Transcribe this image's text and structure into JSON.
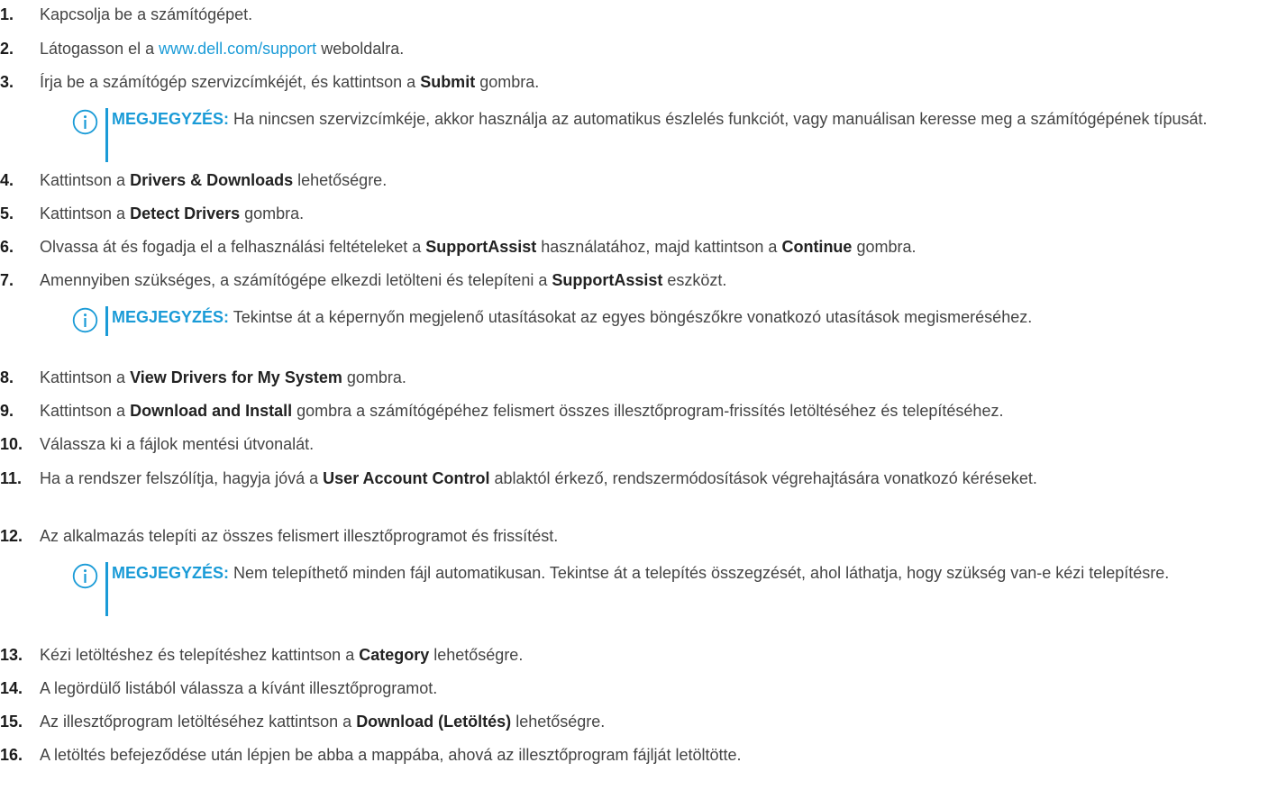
{
  "steps": [
    {
      "num": "1.",
      "parts": [
        {
          "t": "Kapcsolja be a számítógépet."
        }
      ]
    },
    {
      "num": "2.",
      "parts": [
        {
          "t": "Látogasson el a "
        },
        {
          "t": "www.dell.com/support",
          "link": true
        },
        {
          "t": " weboldalra."
        }
      ]
    },
    {
      "num": "3.",
      "parts": [
        {
          "t": "Írja be a számítógép szervizcímkéjét, és kattintson a "
        },
        {
          "t": "Submit",
          "b": true
        },
        {
          "t": " gombra."
        }
      ]
    },
    {
      "num": "4.",
      "parts": [
        {
          "t": "Kattintson a "
        },
        {
          "t": "Drivers & Downloads",
          "b": true
        },
        {
          "t": " lehetőségre."
        }
      ]
    },
    {
      "num": "5.",
      "parts": [
        {
          "t": "Kattintson a "
        },
        {
          "t": "Detect Drivers",
          "b": true
        },
        {
          "t": " gombra."
        }
      ]
    },
    {
      "num": "6.",
      "parts": [
        {
          "t": "Olvassa át és fogadja el a felhasználási feltételeket a "
        },
        {
          "t": "SupportAssist",
          "b": true
        },
        {
          "t": " használatához, majd kattintson a "
        },
        {
          "t": "Continue",
          "b": true
        },
        {
          "t": " gombra."
        }
      ]
    },
    {
      "num": "7.",
      "parts": [
        {
          "t": "Amennyiben szükséges, a számítógépe elkezdi letölteni és telepíteni a "
        },
        {
          "t": "SupportAssist",
          "b": true
        },
        {
          "t": " eszközt."
        }
      ]
    },
    {
      "num": "8.",
      "parts": [
        {
          "t": "Kattintson a "
        },
        {
          "t": "View Drivers for My System",
          "b": true
        },
        {
          "t": " gombra."
        }
      ]
    },
    {
      "num": "9.",
      "parts": [
        {
          "t": "Kattintson a "
        },
        {
          "t": "Download and Install",
          "b": true
        },
        {
          "t": " gombra a számítógépéhez felismert összes illesztőprogram-frissítés letöltéséhez és telepítéséhez."
        }
      ]
    },
    {
      "num": "10.",
      "parts": [
        {
          "t": "Válassza ki a fájlok mentési útvonalát."
        }
      ]
    },
    {
      "num": "11.",
      "parts": [
        {
          "t": "Ha a rendszer felszólítja, hagyja jóvá a "
        },
        {
          "t": "User Account Control",
          "b": true
        },
        {
          "t": " ablaktól érkező, rendszermódosítások végrehajtására vonatkozó kéréseket."
        }
      ]
    },
    {
      "num": "12.",
      "parts": [
        {
          "t": "Az alkalmazás telepíti az összes felismert illesztőprogramot és frissítést."
        }
      ]
    },
    {
      "num": "13.",
      "parts": [
        {
          "t": "Kézi letöltéshez és telepítéshez kattintson a "
        },
        {
          "t": "Category",
          "b": true
        },
        {
          "t": " lehetőségre."
        }
      ]
    },
    {
      "num": "14.",
      "parts": [
        {
          "t": "A legördülő listából válassza a kívánt illesztőprogramot."
        }
      ]
    },
    {
      "num": "15.",
      "parts": [
        {
          "t": "Az illesztőprogram letöltéséhez kattintson a "
        },
        {
          "t": "Download (Letöltés)",
          "b": true
        },
        {
          "t": " lehetőségre."
        }
      ]
    },
    {
      "num": "16.",
      "parts": [
        {
          "t": "A letöltés befejeződése után lépjen be abba a mappába, ahová az illesztőprogram fájlját letöltötte."
        }
      ]
    }
  ],
  "notes": [
    {
      "label": "MEGJEGYZÉS:",
      "text": " Ha nincsen szervizcímkéje, akkor használja az automatikus észlelés funkciót, vagy manuálisan keresse meg a számítógépének típusát."
    },
    {
      "label": "MEGJEGYZÉS:",
      "text": " Tekintse át a képernyőn megjelenő utasításokat az egyes böngészőkre vonatkozó utasítások megismeréséhez."
    },
    {
      "label": "MEGJEGYZÉS:",
      "text": " Nem telepíthető minden fájl automatikusan. Tekintse át a telepítés összegzését, ahol láthatja, hogy szükség van-e kézi telepítésre."
    }
  ],
  "colors": {
    "accent": "#1a9bd7",
    "text": "#444444"
  }
}
